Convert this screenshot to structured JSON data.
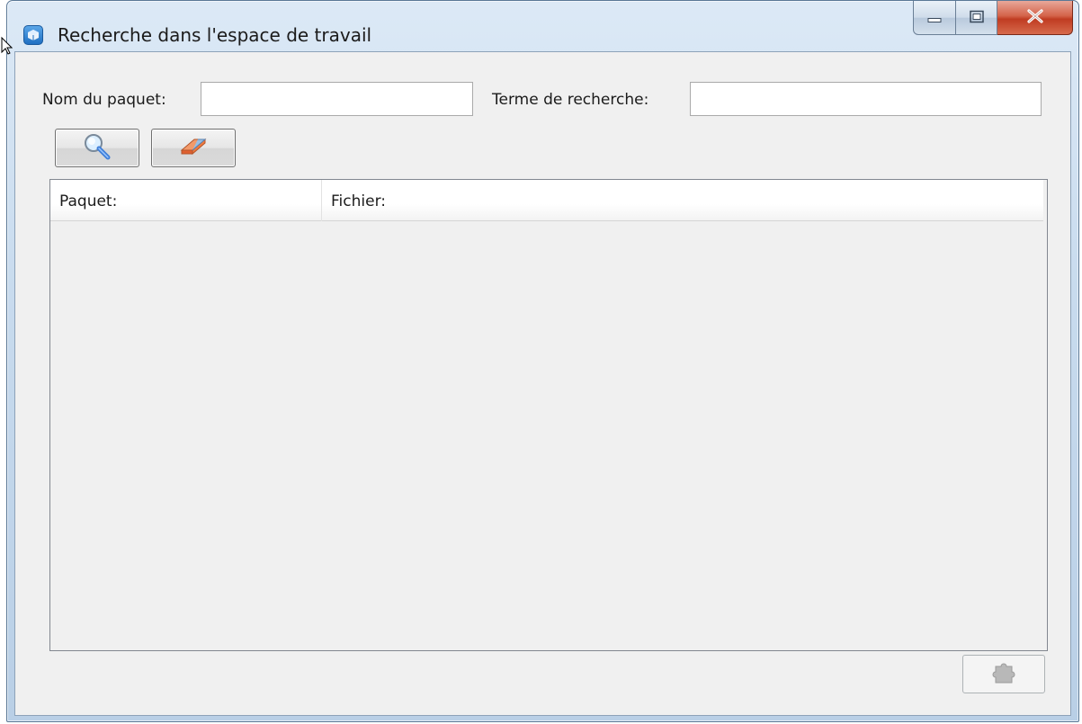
{
  "window": {
    "title": "Recherche dans l'espace de travail"
  },
  "title_controls": {
    "minimize_icon": "minimize-icon",
    "maximize_icon": "maximize-icon",
    "close_icon": "close-icon"
  },
  "search_form": {
    "package_name_label": "Nom du paquet:",
    "package_name_value": "",
    "search_term_label": "Terme de recherche:",
    "search_term_value": ""
  },
  "toolbar": {
    "search_button_icon": "magnifier-icon",
    "clear_button_icon": "eraser-icon"
  },
  "results_table": {
    "columns": [
      "Paquet:",
      "Fichier:"
    ],
    "rows": []
  },
  "footer": {
    "action_button_icon": "puzzle-piece-icon",
    "action_button_enabled": false
  },
  "colors": {
    "title_bar": "#c8dbee",
    "client_background": "#f0f0f0",
    "close_button": "#c03c22"
  }
}
